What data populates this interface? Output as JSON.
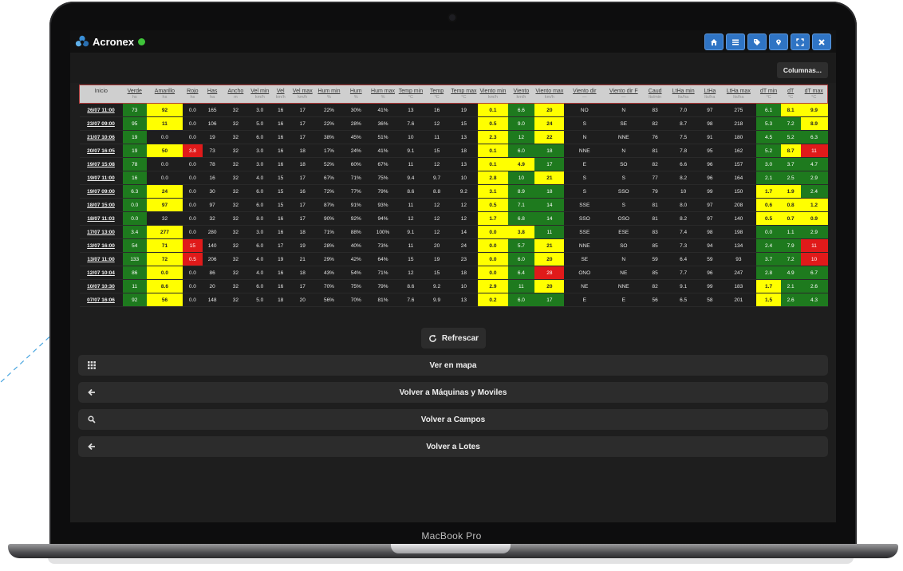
{
  "app": {
    "name": "Acronex",
    "status_color": "#3fc43a"
  },
  "nav_icons": [
    "home-icon",
    "menu-icon",
    "tag-icon",
    "location-icon",
    "fullscreen-icon",
    "close-icon"
  ],
  "columns_button": "Columnas...",
  "table": {
    "headers": [
      {
        "label": "Inicio",
        "unit": ""
      },
      {
        "label": "Verde",
        "unit": "hs"
      },
      {
        "label": "Amarillo",
        "unit": "hs"
      },
      {
        "label": "Rojo",
        "unit": "hs"
      },
      {
        "label": "Has",
        "unit": "ha"
      },
      {
        "label": "Ancho",
        "unit": "m"
      },
      {
        "label": "Vel min",
        "unit": "km/h"
      },
      {
        "label": "Vel",
        "unit": "km/h"
      },
      {
        "label": "Vel max",
        "unit": "km/h"
      },
      {
        "label": "Hum min",
        "unit": "%"
      },
      {
        "label": "Hum",
        "unit": "%"
      },
      {
        "label": "Hum max",
        "unit": "%"
      },
      {
        "label": "Temp min",
        "unit": "°C"
      },
      {
        "label": "Temp",
        "unit": "°C"
      },
      {
        "label": "Temp max",
        "unit": "°C"
      },
      {
        "label": "Viento min",
        "unit": "km/h"
      },
      {
        "label": "Viento",
        "unit": "km/h"
      },
      {
        "label": "Viento max",
        "unit": "km/h"
      },
      {
        "label": "Viento dir",
        "unit": "—"
      },
      {
        "label": "Viento dir F",
        "unit": "—"
      },
      {
        "label": "Caud",
        "unit": "lts/min"
      },
      {
        "label": "LtHa min",
        "unit": "lts/ha"
      },
      {
        "label": "LtHa",
        "unit": "lts/ha"
      },
      {
        "label": "LtHa max",
        "unit": "lts/ha"
      },
      {
        "label": "dT min",
        "unit": "°C"
      },
      {
        "label": "dT",
        "unit": "°C"
      },
      {
        "label": "dT max",
        "unit": "°C"
      }
    ],
    "rows": [
      [
        "26/07 11:00",
        "73",
        "92",
        "0.0",
        "165",
        "32",
        "3.0",
        "16",
        "17",
        "22%",
        "30%",
        "41%",
        "13",
        "16",
        "19",
        "0.1",
        "6.6",
        "20",
        "NO",
        "N",
        "83",
        "7.0",
        "97",
        "275",
        "6.1",
        "8.1",
        "9.9"
      ],
      [
        "23/07 09:00",
        "95",
        "11",
        "0.0",
        "106",
        "32",
        "5.0",
        "16",
        "17",
        "22%",
        "28%",
        "36%",
        "7.6",
        "12",
        "15",
        "0.5",
        "9.0",
        "24",
        "S",
        "SE",
        "82",
        "8.7",
        "98",
        "218",
        "5.3",
        "7.2",
        "8.9"
      ],
      [
        "21/07 10:06",
        "19",
        "0.0",
        "0.0",
        "19",
        "32",
        "6.0",
        "16",
        "17",
        "38%",
        "45%",
        "51%",
        "10",
        "11",
        "13",
        "2.3",
        "12",
        "22",
        "N",
        "NNE",
        "76",
        "7.5",
        "91",
        "180",
        "4.5",
        "5.2",
        "6.3"
      ],
      [
        "20/07 16:05",
        "19",
        "50",
        "3.8",
        "73",
        "32",
        "3.0",
        "16",
        "18",
        "17%",
        "24%",
        "41%",
        "9.1",
        "15",
        "18",
        "0.1",
        "6.0",
        "18",
        "NNE",
        "N",
        "81",
        "7.8",
        "95",
        "162",
        "5.2",
        "8.7",
        "11"
      ],
      [
        "19/07 15:08",
        "78",
        "0.0",
        "0.0",
        "78",
        "32",
        "3.0",
        "16",
        "18",
        "52%",
        "60%",
        "67%",
        "11",
        "12",
        "13",
        "0.1",
        "4.9",
        "17",
        "E",
        "SO",
        "82",
        "6.6",
        "96",
        "157",
        "3.0",
        "3.7",
        "4.7"
      ],
      [
        "19/07 11:00",
        "16",
        "0.0",
        "0.0",
        "16",
        "32",
        "4.0",
        "15",
        "17",
        "67%",
        "71%",
        "75%",
        "9.4",
        "9.7",
        "10",
        "2.8",
        "10",
        "21",
        "S",
        "S",
        "77",
        "8.2",
        "96",
        "164",
        "2.1",
        "2.5",
        "2.9"
      ],
      [
        "19/07 09:00",
        "6.3",
        "24",
        "0.0",
        "30",
        "32",
        "6.0",
        "15",
        "16",
        "72%",
        "77%",
        "79%",
        "8.6",
        "8.8",
        "9.2",
        "3.1",
        "8.9",
        "18",
        "S",
        "SSO",
        "79",
        "10",
        "99",
        "150",
        "1.7",
        "1.9",
        "2.4"
      ],
      [
        "18/07 15:00",
        "0.0",
        "97",
        "0.0",
        "97",
        "32",
        "6.0",
        "15",
        "17",
        "87%",
        "91%",
        "93%",
        "11",
        "12",
        "12",
        "0.5",
        "7.1",
        "14",
        "SSE",
        "S",
        "81",
        "8.0",
        "97",
        "208",
        "0.6",
        "0.8",
        "1.2"
      ],
      [
        "18/07 11:03",
        "0.0",
        "32",
        "0.0",
        "32",
        "32",
        "8.0",
        "16",
        "17",
        "90%",
        "92%",
        "94%",
        "12",
        "12",
        "12",
        "1.7",
        "6.8",
        "14",
        "SSO",
        "OSO",
        "81",
        "8.2",
        "97",
        "140",
        "0.5",
        "0.7",
        "0.9"
      ],
      [
        "17/07 13:00",
        "3.4",
        "277",
        "0.0",
        "280",
        "32",
        "3.0",
        "16",
        "18",
        "71%",
        "88%",
        "100%",
        "9.1",
        "12",
        "14",
        "0.0",
        "3.8",
        "11",
        "SSE",
        "ESE",
        "83",
        "7.4",
        "98",
        "198",
        "0.0",
        "1.1",
        "2.9"
      ],
      [
        "13/07 16:00",
        "54",
        "71",
        "15",
        "140",
        "32",
        "6.0",
        "17",
        "19",
        "28%",
        "40%",
        "73%",
        "11",
        "20",
        "24",
        "0.0",
        "5.7",
        "21",
        "NNE",
        "SO",
        "85",
        "7.3",
        "94",
        "134",
        "2.4",
        "7.9",
        "11"
      ],
      [
        "13/07 11:00",
        "133",
        "72",
        "0.5",
        "206",
        "32",
        "4.0",
        "19",
        "21",
        "29%",
        "42%",
        "64%",
        "15",
        "19",
        "23",
        "0.0",
        "6.0",
        "20",
        "SE",
        "N",
        "59",
        "6.4",
        "59",
        "93",
        "3.7",
        "7.2",
        "10"
      ],
      [
        "12/07 10:04",
        "86",
        "0.0",
        "0.0",
        "86",
        "32",
        "4.0",
        "16",
        "18",
        "43%",
        "54%",
        "71%",
        "12",
        "15",
        "18",
        "0.0",
        "6.4",
        "28",
        "ONO",
        "NE",
        "85",
        "7.7",
        "96",
        "247",
        "2.8",
        "4.9",
        "6.7"
      ],
      [
        "10/07 10:30",
        "11",
        "8.6",
        "0.0",
        "20",
        "32",
        "6.0",
        "16",
        "17",
        "70%",
        "75%",
        "79%",
        "8.6",
        "9.2",
        "10",
        "2.9",
        "11",
        "20",
        "NE",
        "NNE",
        "82",
        "9.1",
        "99",
        "183",
        "1.7",
        "2.1",
        "2.6"
      ],
      [
        "07/07 16:06",
        "92",
        "56",
        "0.0",
        "148",
        "32",
        "5.0",
        "18",
        "20",
        "56%",
        "70%",
        "81%",
        "7.6",
        "9.9",
        "13",
        "0.2",
        "6.0",
        "17",
        "E",
        "E",
        "56",
        "6.5",
        "58",
        "201",
        "1.5",
        "2.6",
        "4.3"
      ]
    ],
    "cell_colors": {
      "1": [
        "g",
        "g",
        "g",
        "g",
        "g",
        "g",
        "g",
        "g",
        "g",
        "g",
        "g",
        "g",
        "g",
        "g",
        "g"
      ],
      "2": [
        "y",
        "y",
        "",
        "y",
        "",
        "",
        "y",
        "y",
        "",
        "y",
        "y",
        "y",
        "y",
        "y",
        "y"
      ],
      "3": [
        "",
        "",
        "",
        "r",
        "",
        "",
        "",
        "",
        "",
        "",
        "r",
        "r",
        "",
        "",
        ""
      ],
      "15": [
        "y",
        "y",
        "y",
        "y",
        "y",
        "y",
        "y",
        "y",
        "y",
        "y",
        "y",
        "y",
        "y",
        "y",
        "y"
      ],
      "16": [
        "g",
        "g",
        "g",
        "g",
        "y",
        "g",
        "g",
        "g",
        "g",
        "y",
        "g",
        "g",
        "g",
        "g",
        "g"
      ],
      "17": [
        "y",
        "y",
        "y",
        "g",
        "g",
        "y",
        "g",
        "g",
        "g",
        "g",
        "y",
        "y",
        "r",
        "y",
        "g"
      ],
      "24": [
        "g",
        "g",
        "g",
        "g",
        "g",
        "g",
        "y",
        "y",
        "y",
        "g",
        "g",
        "g",
        "g",
        "y",
        "y"
      ],
      "25": [
        "y",
        "g",
        "g",
        "y",
        "g",
        "g",
        "y",
        "y",
        "y",
        "g",
        "g",
        "g",
        "g",
        "g",
        "g"
      ],
      "26": [
        "y",
        "y",
        "g",
        "r",
        "g",
        "g",
        "g",
        "y",
        "y",
        "g",
        "r",
        "r",
        "g",
        "g",
        "g"
      ]
    }
  },
  "buttons": {
    "refresh": "Refrescar",
    "map": "Ver en mapa",
    "machines": "Volver a Máquinas y Moviles",
    "fields": "Volver a Campos",
    "lots": "Volver a Lotes"
  },
  "device_label": "MacBook Pro"
}
